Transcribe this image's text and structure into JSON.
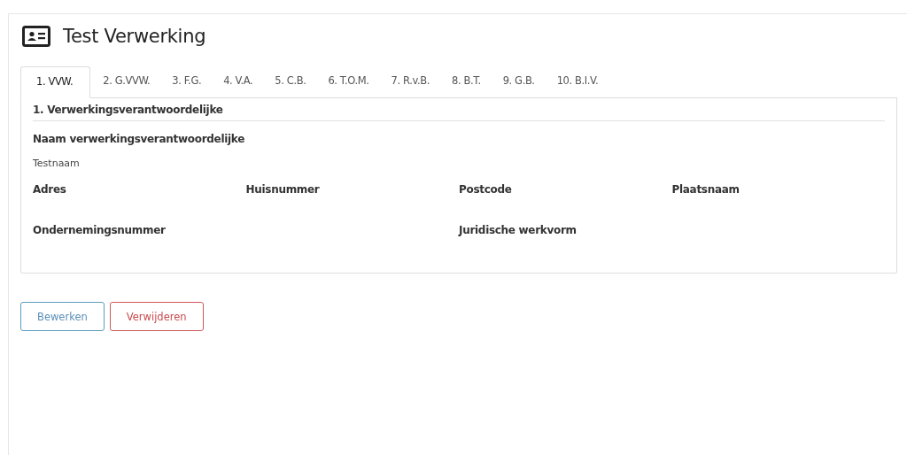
{
  "title": "Test Verwerking",
  "tabs": [
    {
      "label": "1. VVW.",
      "selected": true
    },
    {
      "label": "2. G.VVW.",
      "selected": false
    },
    {
      "label": "3. F.G.",
      "selected": false
    },
    {
      "label": "4. V.A.",
      "selected": false
    },
    {
      "label": "5. C.B.",
      "selected": false
    },
    {
      "label": "6. T.O.M.",
      "selected": false
    },
    {
      "label": "7. R.v.B.",
      "selected": false
    },
    {
      "label": "8. B.T.",
      "selected": false
    },
    {
      "label": "9. G.B.",
      "selected": false
    },
    {
      "label": "10. B.I.V.",
      "selected": false
    }
  ],
  "section": {
    "heading": "1. Verwerkingsverantwoordelijke",
    "rows": [
      [
        {
          "label": "Naam verwerkingsverantwoordelijke",
          "value": "Testnaam"
        }
      ],
      [
        {
          "label": "Adres"
        },
        {
          "label": "Huisnummer"
        },
        {
          "label": "Postcode"
        },
        {
          "label": "Plaatsnaam"
        }
      ],
      [
        {
          "label": "Ondernemingsnummer"
        },
        null,
        {
          "label": "Juridische werkvorm"
        },
        null
      ]
    ]
  },
  "buttons": [
    {
      "label": "Bewerken",
      "kind": "edit"
    },
    {
      "label": "Verwijderen",
      "kind": "delete"
    }
  ]
}
